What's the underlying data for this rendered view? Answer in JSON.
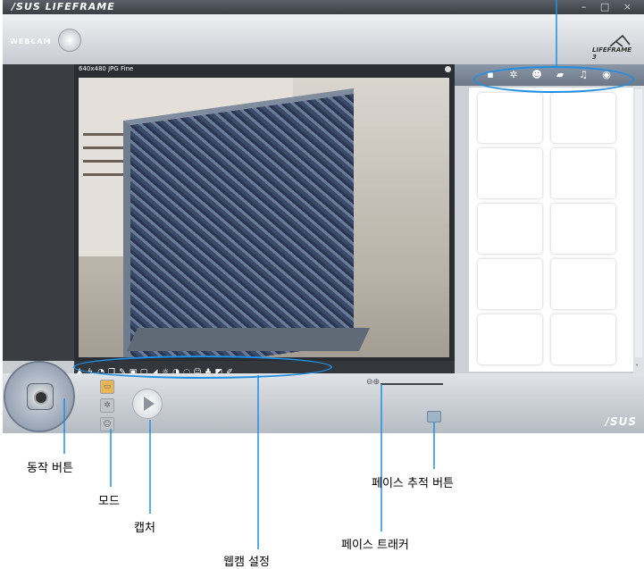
{
  "window": {
    "brand": "/SUS LIFEFRAME",
    "controls": "– □ ×"
  },
  "header": {
    "webcam_badge": "WEBCAM",
    "lifeframe_logo": "LIFEFRAME 3"
  },
  "viewport": {
    "resolution_label": "640x480 JPG Fine"
  },
  "toolbar": {
    "icons": [
      "person-icon",
      "flash-icon",
      "timer-icon",
      "copy-icon",
      "pencil-icon",
      "frame-icon",
      "frame2-icon",
      "contrast-icon",
      "brightness-icon",
      "halfcircle-icon",
      "shield-icon",
      "face-icon",
      "color-icon",
      "window-icon",
      "wrench-icon"
    ]
  },
  "right_tabs": [
    "camera-icon",
    "gear-icon",
    "face-icon",
    "video-icon",
    "mic-icon",
    "eye-icon"
  ],
  "brand_corner": "/SUS",
  "annotations": {
    "action_button": "동작 버튼",
    "mode": "모드",
    "capture": "캡처",
    "webcam_settings": "웹캠 설정",
    "face_tracker": "페이스 트래커",
    "face_tracking_button": "페이스 추적 버튼"
  },
  "colors": {
    "highlight": "#1f8fe5"
  }
}
